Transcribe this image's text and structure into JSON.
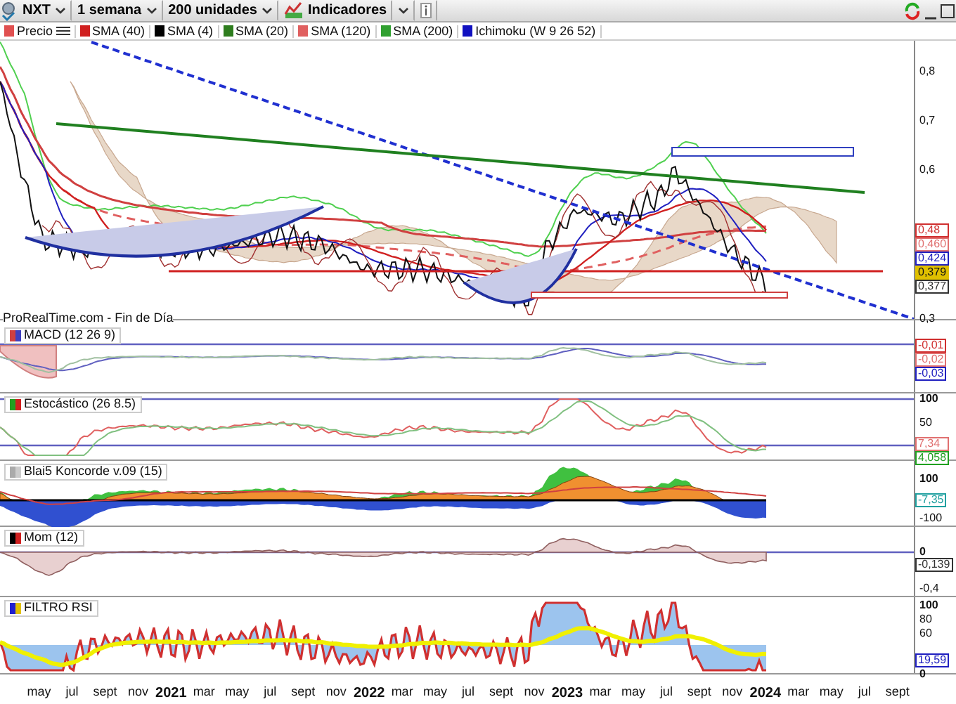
{
  "toolbar": {
    "symbol": "NXT",
    "period": "1 semana",
    "units": "200 unidades",
    "indicators_button": "Indicadores"
  },
  "legend": [
    {
      "label": "Precio",
      "color": "#e05050"
    },
    {
      "label": "SMA (40)",
      "color": "#d02020"
    },
    {
      "label": "SMA (4)",
      "color": "#000000"
    },
    {
      "label": "SMA (20)",
      "color": "#2e7d1e"
    },
    {
      "label": "SMA (120)",
      "color": "#e06060"
    },
    {
      "label": "SMA (200)",
      "color": "#30a030"
    },
    {
      "label": "Ichimoku (W 9 26 52)",
      "color": "#1010c0"
    }
  ],
  "price_panel": {
    "axis_ticks": [
      "0,8",
      "0,7",
      "0,6",
      "0,3"
    ],
    "value_labels": [
      {
        "text": "0,48",
        "color": "#d03030"
      },
      {
        "text": "0,460",
        "color": "#e07070"
      },
      {
        "text": "0,424",
        "color": "#2020c0"
      },
      {
        "text": "0,379",
        "color": "#e0c000"
      },
      {
        "text": "0,377",
        "color": "#333333"
      }
    ]
  },
  "source_label": "ProRealTime.com - Fin de Día",
  "indicators": [
    {
      "kind": "macd",
      "title": "MACD (12 26 9)",
      "value_labels": [
        {
          "text": "-0,01",
          "color": "#d03030"
        },
        {
          "text": "-0,02",
          "color": "#e07070"
        },
        {
          "text": "-0,03",
          "color": "#2020c0"
        }
      ]
    },
    {
      "kind": "stochastic",
      "title": "Estocástico (26 8.5)",
      "axis_ticks": [
        "100",
        "50"
      ],
      "value_labels": [
        {
          "text": "7,34",
          "color": "#e07070"
        },
        {
          "text": "4,058",
          "color": "#20a020"
        }
      ]
    },
    {
      "kind": "koncorde",
      "title": "Blai5 Koncorde v.09 (15)",
      "axis_ticks": [
        "100",
        "-100"
      ],
      "value_labels": [
        {
          "text": "-7,35",
          "color": "#20a0a0"
        }
      ]
    },
    {
      "kind": "momentum",
      "title": "Mom (12)",
      "axis_ticks": [
        "0",
        "-0,4"
      ],
      "value_labels": [
        {
          "text": "-0,139",
          "color": "#333333"
        }
      ]
    },
    {
      "kind": "rsi",
      "title": "FILTRO RSI",
      "axis_ticks": [
        "100",
        "80",
        "60",
        "0"
      ],
      "value_labels": [
        {
          "text": "19,59",
          "color": "#2020c0"
        }
      ]
    }
  ],
  "x_axis": [
    {
      "label": "may",
      "year": false
    },
    {
      "label": "jul",
      "year": false
    },
    {
      "label": "sept",
      "year": false
    },
    {
      "label": "nov",
      "year": false
    },
    {
      "label": "2021",
      "year": true
    },
    {
      "label": "mar",
      "year": false
    },
    {
      "label": "may",
      "year": false
    },
    {
      "label": "jul",
      "year": false
    },
    {
      "label": "sept",
      "year": false
    },
    {
      "label": "nov",
      "year": false
    },
    {
      "label": "2022",
      "year": true
    },
    {
      "label": "mar",
      "year": false
    },
    {
      "label": "may",
      "year": false
    },
    {
      "label": "jul",
      "year": false
    },
    {
      "label": "sept",
      "year": false
    },
    {
      "label": "nov",
      "year": false
    },
    {
      "label": "2023",
      "year": true
    },
    {
      "label": "mar",
      "year": false
    },
    {
      "label": "may",
      "year": false
    },
    {
      "label": "jul",
      "year": false
    },
    {
      "label": "sept",
      "year": false
    },
    {
      "label": "nov",
      "year": false
    },
    {
      "label": "2024",
      "year": true
    },
    {
      "label": "mar",
      "year": false
    },
    {
      "label": "may",
      "year": false
    },
    {
      "label": "jul",
      "year": false
    },
    {
      "label": "sept",
      "year": false
    }
  ]
}
